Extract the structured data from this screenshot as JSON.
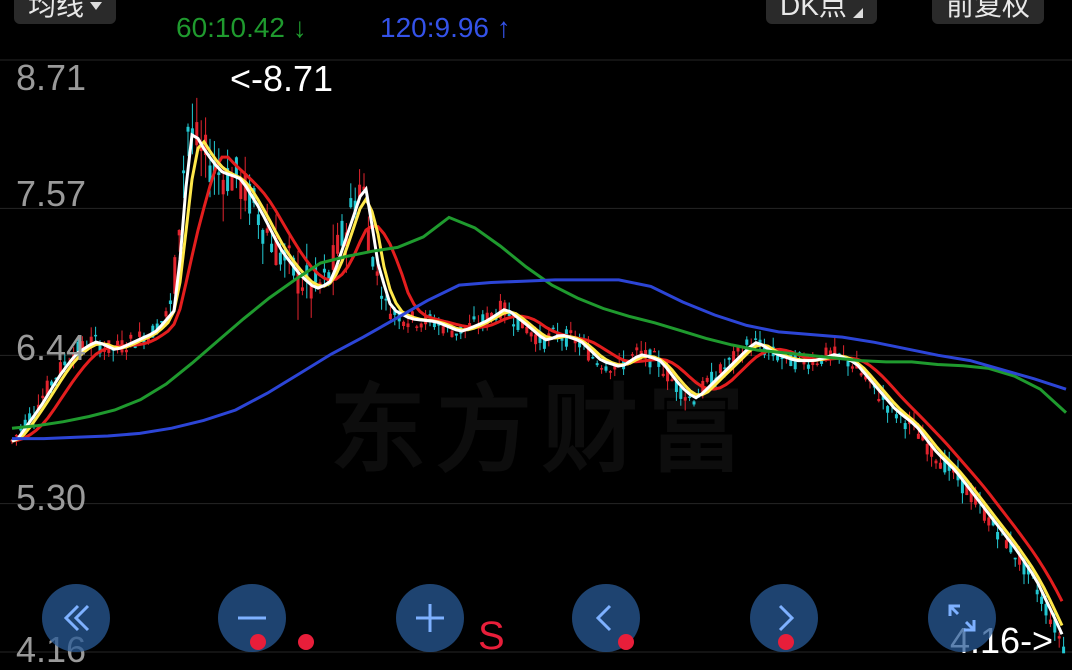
{
  "toolbar": {
    "indicator_label": "均线",
    "point_label": "DK点",
    "adjust_label": "前复权",
    "ma60_text": "60:10.42 ↓",
    "ma120_text": "120:9.96 ↑"
  },
  "yaxis": {
    "ticks": [
      "8.71",
      "7.57",
      "6.44",
      "5.30",
      "4.16"
    ]
  },
  "annotations": {
    "high": "<-8.71",
    "low": "4.16->"
  },
  "watermark": "东方财富",
  "signal": "S",
  "colors": {
    "up": "#e2242e",
    "down": "#23c8d2",
    "ma_white": "#ffffff",
    "ma_yellow": "#ffe84a",
    "ma_red": "#e41e1e",
    "ma_green": "#1f9a2e",
    "ma_blue": "#2c45d6",
    "button": "#285a96",
    "signal": "#e81e3a"
  },
  "chart_data": {
    "type": "candlestick",
    "y_range": [
      4.16,
      8.71
    ],
    "ticks": [
      8.71,
      7.57,
      6.44,
      5.3,
      4.16
    ],
    "high": 8.71,
    "low": 4.16,
    "series": [
      {
        "name": "60",
        "last": 10.42,
        "color": "#1f9a2e",
        "values": [
          5.88,
          5.9,
          5.93,
          5.97,
          6.02,
          6.1,
          6.22,
          6.38,
          6.55,
          6.72,
          6.88,
          7.02,
          7.15,
          7.2,
          7.24,
          7.27,
          7.35,
          7.5,
          7.42,
          7.28,
          7.12,
          6.98,
          6.88,
          6.8,
          6.74,
          6.69,
          6.63,
          6.57,
          6.52,
          6.48,
          6.46,
          6.44,
          6.42,
          6.4,
          6.39,
          6.39,
          6.37,
          6.36,
          6.34,
          6.28,
          6.18,
          6.0
        ]
      },
      {
        "name": "120",
        "last": 9.96,
        "color": "#2c45d6",
        "values": [
          5.8,
          5.8,
          5.81,
          5.82,
          5.84,
          5.88,
          5.94,
          6.02,
          6.15,
          6.3,
          6.45,
          6.58,
          6.72,
          6.86,
          6.98,
          7.0,
          7.01,
          7.02,
          7.02,
          7.02,
          6.97,
          6.85,
          6.75,
          6.67,
          6.62,
          6.6,
          6.58,
          6.54,
          6.49,
          6.44,
          6.4,
          6.33,
          6.26,
          6.18
        ]
      }
    ]
  }
}
